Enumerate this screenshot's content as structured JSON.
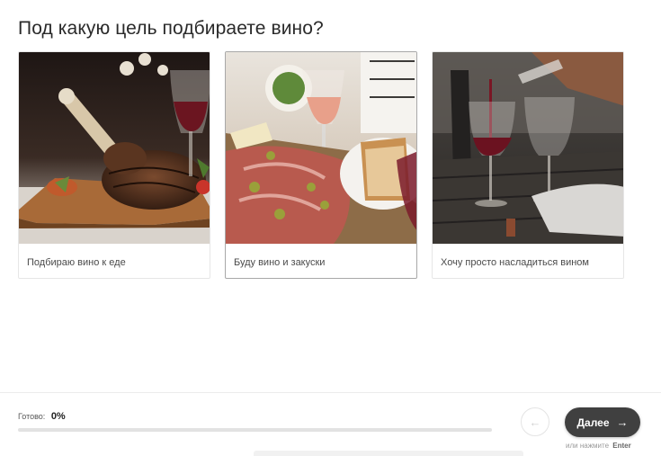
{
  "question": "Под какую цель подбираете вино?",
  "options": [
    {
      "label": "Подбираю вино к еде",
      "image": "steak-photo",
      "selected": false
    },
    {
      "label": "Буду вино и закуски",
      "image": "charcuterie-photo",
      "selected": true
    },
    {
      "label": "Хочу просто насладиться вином",
      "image": "wine-pour-photo",
      "selected": false
    }
  ],
  "progress": {
    "label": "Готово:",
    "value": "0%",
    "fraction": 0
  },
  "nav": {
    "prev_icon": "arrow-left-icon",
    "next_label": "Далее",
    "next_icon": "arrow-right-icon",
    "hint_prefix": "или нажмите",
    "hint_key": "Enter"
  },
  "colors": {
    "next_button": "#404040",
    "progress_track": "#e2e2e2",
    "text": "#2a2a2a"
  }
}
